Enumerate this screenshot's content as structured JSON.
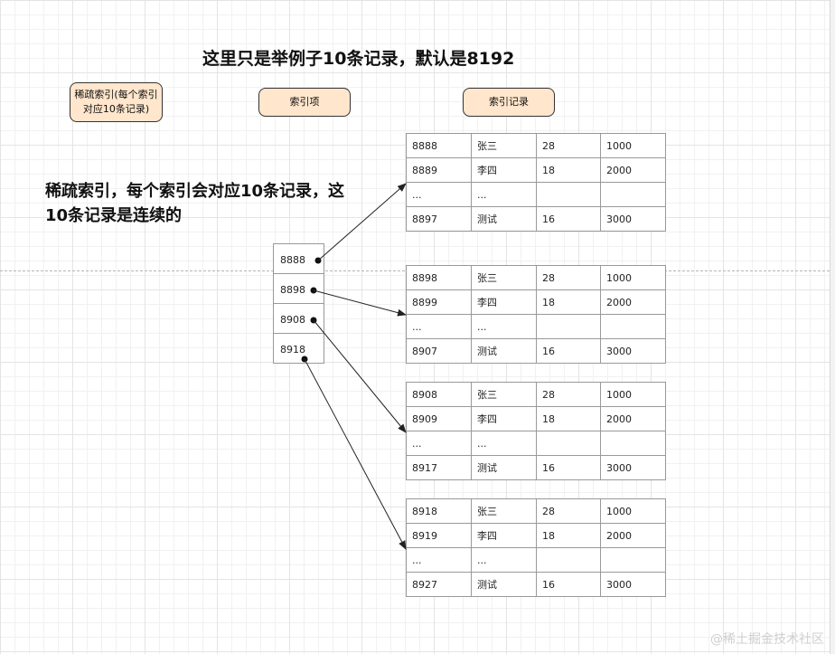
{
  "title": "这里只是举例子10条记录，默认是8192",
  "note": "稀疏索引，每个索引会对应10条记录，这10条记录是连续的",
  "labels": {
    "sparse_index": "稀疏索引(每个索引对应10条记录)",
    "index_item": "索引项",
    "index_record": "索引记录"
  },
  "index_entries": [
    "8888",
    "8898",
    "8908",
    "8918"
  ],
  "record_groups": [
    [
      [
        "8888",
        "张三",
        "28",
        "1000"
      ],
      [
        "8889",
        "李四",
        "18",
        "2000"
      ],
      [
        "...",
        "...",
        "",
        ""
      ],
      [
        "8897",
        "测试",
        "16",
        "3000"
      ]
    ],
    [
      [
        "8898",
        "张三",
        "28",
        "1000"
      ],
      [
        "8899",
        "李四",
        "18",
        "2000"
      ],
      [
        "...",
        "...",
        "",
        ""
      ],
      [
        "8907",
        "测试",
        "16",
        "3000"
      ]
    ],
    [
      [
        "8908",
        "张三",
        "28",
        "1000"
      ],
      [
        "8909",
        "李四",
        "18",
        "2000"
      ],
      [
        "...",
        "...",
        "",
        ""
      ],
      [
        "8917",
        "测试",
        "16",
        "3000"
      ]
    ],
    [
      [
        "8918",
        "张三",
        "28",
        "1000"
      ],
      [
        "8919",
        "李四",
        "18",
        "2000"
      ],
      [
        "...",
        "...",
        "",
        ""
      ],
      [
        "8927",
        "测试",
        "16",
        "3000"
      ]
    ]
  ],
  "colors": {
    "pill_fill": "#ffe6cc",
    "stroke": "#333333"
  },
  "watermark": "@稀土掘金技术社区"
}
